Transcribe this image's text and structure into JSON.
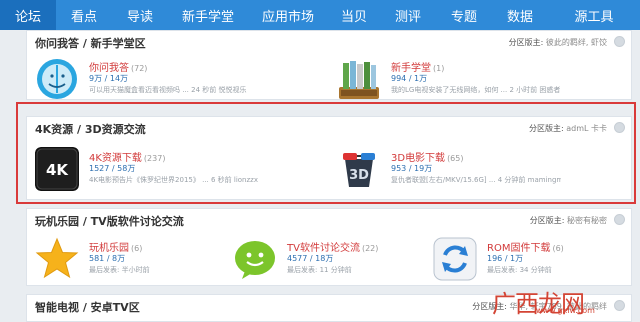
{
  "nav": {
    "tabs": [
      {
        "label": "论坛",
        "active": true
      },
      {
        "label": "看点",
        "active": false
      },
      {
        "label": "导读",
        "active": false
      },
      {
        "label": "新手学堂",
        "active": false
      },
      {
        "label": "应用市场",
        "active": false
      },
      {
        "label": "当贝",
        "active": false
      },
      {
        "label": "测评",
        "active": false
      },
      {
        "label": "专题",
        "active": false
      },
      {
        "label": "数据",
        "active": false
      },
      {
        "label": "源工具",
        "active": false
      }
    ]
  },
  "sections": [
    {
      "title": "你问我答 / 新手学堂区",
      "mods_label": "分区版主:",
      "mods_names": "彼此的羁绊, 虾饺",
      "forums": [
        {
          "icon": "finder-face-icon",
          "name": "你问我答",
          "count": "(72)",
          "stats": "9万 / 14万",
          "last": "可以用天猫魔盒看迈看视频吗 ... 24 秒前 悦悦视乐"
        },
        {
          "icon": "books-icon",
          "name": "新手学堂",
          "count": "(1)",
          "stats": "994 / 1万",
          "last": "我的LG电视安装了无线网络，如何 ... 2 小时前 困惑者"
        }
      ]
    },
    {
      "title": "4K资源 / 3D资源交流",
      "mods_label": "分区版主:",
      "mods_names": "admL 卡卡",
      "forums": [
        {
          "icon": "4k-badge-icon",
          "name": "4K资源下载",
          "count": "(237)",
          "stats": "1527 / 58万",
          "last": "4K电影预告片《侏罗纪世界2015》 ... 6 秒前 lionzzx"
        },
        {
          "icon": "3d-glasses-icon",
          "name": "3D电影下载",
          "count": "(65)",
          "stats": "953 / 19万",
          "last": "复仇者联盟[左右/MKV/15.6G] ... 4 分钟前 mamingmj"
        }
      ]
    },
    {
      "title": "玩机乐园 / TV版软件讨论交流",
      "mods_label": "分区版主:",
      "mods_names": "秘密有秘密",
      "forums": [
        {
          "icon": "star-icon",
          "name": "玩机乐园",
          "count": "(6)",
          "stats": "581 / 8万",
          "last": "最后发表: 半小时前"
        },
        {
          "icon": "android-chat-icon",
          "name": "TV软件讨论交流",
          "count": "(22)",
          "stats": "4577 / 18万",
          "last": "最后发表: 11 分钟前"
        },
        {
          "icon": "refresh-icon",
          "name": "ROM固件下载",
          "count": "(6)",
          "stats": "196 / 1万",
          "last": "最后发表: 34 分钟前"
        }
      ]
    },
    {
      "title": "智能电视 / 安卓TV区",
      "mods_label": "分区版主:",
      "mods_names": "华华, 轩宇789, 彼此的羁绊",
      "forums": []
    }
  ],
  "watermark": {
    "text": "广西龙网",
    "url": "www.gxlw.com"
  },
  "colors": {
    "nav": "#2f8ad8",
    "nav_active": "#1b6fbd",
    "forum_link": "#d23a3a",
    "highlight": "#d93a3a"
  }
}
